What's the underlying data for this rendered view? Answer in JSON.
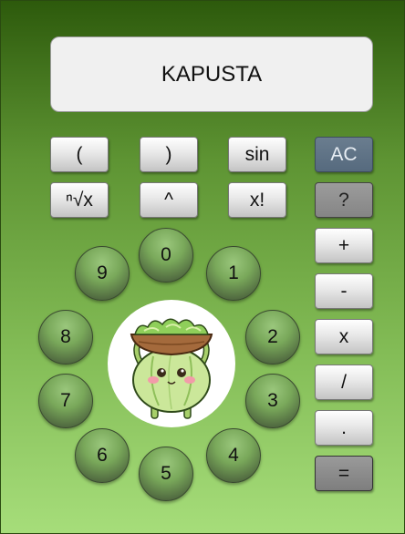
{
  "display": {
    "value": "KAPUSTA"
  },
  "function_keys": [
    "(",
    ")",
    "sin",
    "ⁿ√x",
    "^",
    "x!"
  ],
  "side_keys": {
    "ac": "AC",
    "help": "?",
    "plus": "+",
    "minus": "-",
    "multiply": "x",
    "divide": "/",
    "decimal": ".",
    "equals": "="
  },
  "digits": [
    "0",
    "1",
    "2",
    "3",
    "4",
    "5",
    "6",
    "7",
    "8",
    "9"
  ],
  "mascot": {
    "name": "cabbage-mascot-with-salad-bowl"
  }
}
